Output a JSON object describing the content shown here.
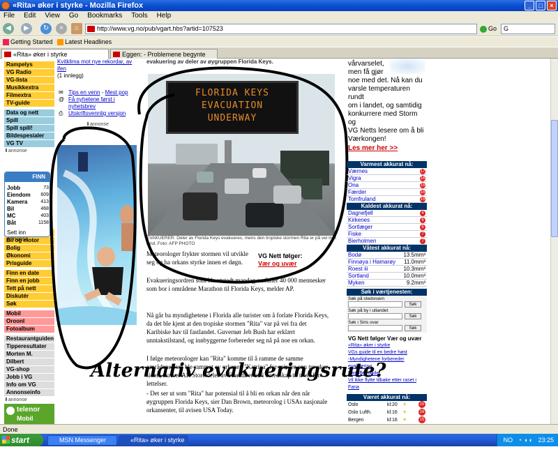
{
  "window": {
    "title": "«Rita» øker i styrke - Mozilla Firefox"
  },
  "menu": [
    "File",
    "Edit",
    "View",
    "Go",
    "Bookmarks",
    "Tools",
    "Help"
  ],
  "nav": {
    "url": "http://www.vg.no/pub/vgart.hbs?artid=107523",
    "go_label": "Go",
    "search_value": "G"
  },
  "bookmarks": [
    "Getting Started",
    "Latest Headlines"
  ],
  "tabs": [
    "«Rita» øker i styrke",
    "Eggen: - Problemene begynte under Hareide"
  ],
  "leftnav": {
    "group1": [
      "Rampelys",
      "VG Radio",
      "VG-lista",
      "Musikkextra",
      "Filmextra",
      "TV-guide"
    ],
    "group2": [
      "Data og nett",
      "Spill",
      "Spill spill!",
      "Bildespesialer",
      "VG TV"
    ],
    "annonse": "annonse",
    "finn_logo": "FINN",
    "finn_rows": [
      {
        "label": "Jobb",
        "count": "73"
      },
      {
        "label": "Eiendom",
        "count": "609"
      },
      {
        "label": "Kamera",
        "count": "413"
      },
      {
        "label": "Bil",
        "count": "468"
      },
      {
        "label": "MC",
        "count": "403"
      },
      {
        "label": "Båt",
        "count": "1158"
      }
    ],
    "finn_cta": "Sett inn annonse",
    "group3": [
      "Mat og drikke",
      "Bil og motor",
      "Bolig",
      "Økonomi",
      "Prisguide"
    ],
    "group4": [
      "Finn en date",
      "Finn en jobb",
      "Tett på nett",
      "Diskutér",
      "Søk"
    ],
    "group5": [
      "Mobil",
      "Oroonl",
      "Fotoalbum"
    ],
    "group6": [
      "Restaurantguiden",
      "Tipperesultater",
      "Morten M.",
      "Dilbert",
      "VG-shop",
      "Jobb i VG",
      "Info om VG",
      "Annonseinfo"
    ],
    "annonse2": "annonse",
    "telenor": "telenor",
    "telenor_sub": "Mobil"
  },
  "midcol": {
    "topline": "Kvitklima mot nye rekordar, av ifen",
    "topline2": "(1 innlegg)",
    "tools": [
      "Tips en venn",
      "Mest pop",
      "Få nyhetene først i nyhetsbrev",
      "Utskriftsvennlig versjon"
    ],
    "annonse": "annonse"
  },
  "article": {
    "top_cut": "evakuering av deler av øygruppen Florida Keys.",
    "photo_sign": [
      "FLORIDA KEYS",
      "EVACUATION",
      "UNDERWAY"
    ],
    "caption": "EVAKUERER: Deler av Florida Keys evakueres, mens den tropiske stormen Rita er på vei mot land. Foto: AFP PHOTO",
    "lead1": "Meteorologer frykter stormen vil utvikle",
    "lead2": "seg og ha orkans styrke innen et døgn.",
    "nett_title": "VG Nett følger:",
    "nett_link": "Vær og uvær",
    "p1": "Evakueringsordren som ble utstedt mandag omfatter 40 000 mennesker som bor i områdene Marathon til Florida Keys, melder AP.",
    "p2": "Nå går ba myndighetene i Florida alle turister om å forlate Florida Keys, da det ble kjent at den tropiske stormen \"Rita\" var på vei fra det Karibiske hav til fastlandet. Guvernør Jeb Bush har erklært unntakstilstand, og innbyggerne forbereder seg nå på noe en orkan.",
    "p3": "I følge meteorologer kan \"Rita\" komme til å ramme de samme områdene som ble rammet av orkanen \"Katrina\" for mindre enn tre uker siden, skriver AP. Store deler av Florida er nå i beredskap til tross for lettelser.",
    "p4": "- Det ser ut som \"Rita\" har potensial til å bli en orkan når den når øygruppen Florida Keys, sier Dan Brown, meteorolog i USAs nasjonale orkansenter, til avisen USA Today."
  },
  "rightcol": {
    "intro": [
      "vårvarselet,",
      "men få gjør",
      "noe med det. Nå kan du",
      "varsle temperaturen rundt",
      "om i landet, og samtidig",
      "konkurrere med Storm og",
      "VG Netts lesere om å bli",
      "Værkongen!"
    ],
    "les_mer": "Les mer her >>",
    "varmest_title": "Varmest akkurat nå:",
    "varmest": [
      {
        "place": "Værnes",
        "v": "17"
      },
      {
        "place": "Vigra",
        "v": "16"
      },
      {
        "place": "Ona",
        "v": "15"
      },
      {
        "place": "Færder",
        "v": "15"
      },
      {
        "place": "Tomfruland",
        "v": "15"
      }
    ],
    "kaldest_title": "Kaldest akkurat nå:",
    "kaldest": [
      {
        "place": "Dagnefjell",
        "v": "4"
      },
      {
        "place": "Kirkenes",
        "v": "6"
      },
      {
        "place": "Sortlæger",
        "v": "6"
      },
      {
        "place": "Fiske",
        "v": "7"
      },
      {
        "place": "Bierholmen",
        "v": "7"
      }
    ],
    "vatest_title": "Våtest akkurat nå:",
    "vatest": [
      {
        "place": "Bodø",
        "v": "13.5mm³"
      },
      {
        "place": "Finnøya i Hamarøy",
        "v": "11.0mm³"
      },
      {
        "place": "Roest iii",
        "v": "10.3mm³"
      },
      {
        "place": "Sortland",
        "v": "10.0mm³"
      },
      {
        "place": "Myken",
        "v": "9.2mm³"
      }
    ],
    "sok_title": "Søk i værtjenesten:",
    "sok_labels": [
      "Søk på stedsnavn",
      "Søk på by i utlandet",
      "Søk i Siris ovar"
    ],
    "sok_btn": "Søk",
    "folger_title": "VG Nett følger Vær og uvær",
    "folger_links": [
      "«Rita» øker i styrke",
      "VGs guide til en bedre høst",
      "-Myndighetene forbereder evakuering",
      "Rasoffer døde",
      "Vil ikke flytte tilbake etter raset i Fana"
    ],
    "varet_title": "Været akkurat nå:",
    "varet": [
      {
        "place": "Oslo",
        "time": "kl:20",
        "t": "15"
      },
      {
        "place": "Oslo Lufth.",
        "time": "kl:16",
        "t": "16"
      },
      {
        "place": "Bergen",
        "time": "kl:16",
        "t": "15"
      }
    ]
  },
  "annotation": "Alternativ evakueringsrute?",
  "status": "Done",
  "taskbar": {
    "start": "start",
    "tasks": [
      "MSN Messenger",
      "«Rita» øker i styrke - ..."
    ],
    "tray_lang": "NO",
    "clock": "23:25"
  }
}
